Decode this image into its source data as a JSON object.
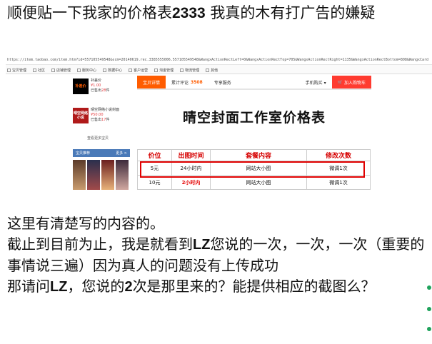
{
  "post": {
    "heading_a": "顺便贴一下我家的价格表",
    "heading_b": "2333",
    "heading_c": " 我真的木有打广告的嫌疑"
  },
  "screenshot": {
    "url": "https://item.taobao.com/item.htm?id=557105549548&scm=20140619.rec.3385555006.557105549548&WangxActionRectLeft=0&WangxActionRectTop=705&WangxActionRectRight=1135&WangxActionRectBottom=808&WangxCard",
    "bookmarks": [
      "宝贝管理",
      "社区",
      "店铺管理",
      "服务中心",
      "数据中心",
      "客户运营",
      "淘金管理",
      "物流管理",
      "其他"
    ],
    "sidebar": {
      "items": [
        {
          "thumb": "补差价",
          "name": "补差价",
          "price": "¥1.00",
          "sold_prefix": "已售出",
          "sold": "28",
          "sold_suffix": "件"
        },
        {
          "thumb": "晴空网络小说",
          "name": "晴空网络小说封面",
          "price": "¥50.00",
          "sold_prefix": "已售出",
          "sold": "17",
          "sold_suffix": "件"
        }
      ],
      "more": "查看更多宝贝",
      "section_title": "宝贝推荐",
      "section_more": "更多 >"
    },
    "tabs": {
      "details": "宝贝详情",
      "reviews": "累计评论",
      "review_count": "3508",
      "service": "专享服务",
      "mobile": "手机购买",
      "cart": "加入购物车"
    },
    "price_table": {
      "title": "晴空封面工作室价格表",
      "headers": [
        "价位",
        "出图时间",
        "套餐内容",
        "修改次数"
      ],
      "rows": [
        [
          "5元",
          "24小时内",
          "网站大小图",
          "微调1次"
        ],
        [
          "10元",
          "2小时内",
          "网站大小图",
          "微调1次"
        ]
      ]
    }
  },
  "body": {
    "line1": "这里有清楚写的内容的。",
    "line2a": "截止到目前为止，我是就看到",
    "line2b": "LZ",
    "line2c": "您说的一次，一次，一次（重要的事情说三遍）因为真人的问题没有上传成功",
    "line3a": "那请问",
    "line3b": "LZ",
    "line3c": "，您说的",
    "line3d": "2",
    "line3e": "次是那里来的？能提供相应的截图么？"
  }
}
